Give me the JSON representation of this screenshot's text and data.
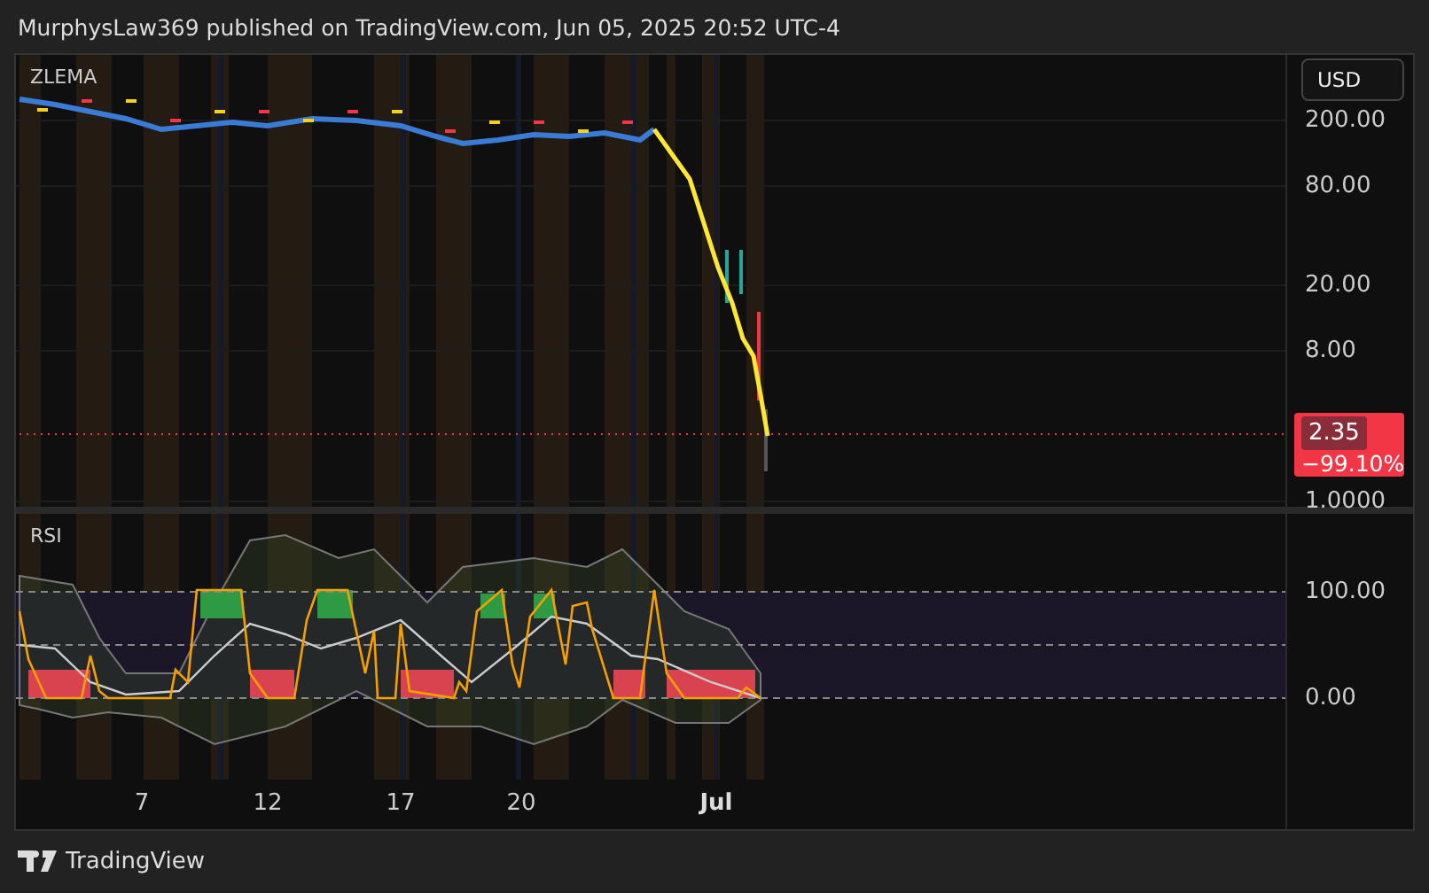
{
  "header": {
    "text": "MurphysLaw369 published on TradingView.com, Jun 05, 2025 20:52 UTC-4"
  },
  "price_pane": {
    "indicator": "ZLEMA",
    "currency": "USD",
    "axis_labels": [
      "200.00",
      "80.00",
      "20.00",
      "8.00",
      "1.0000"
    ],
    "last_price": "2.35",
    "change": "−99.10%"
  },
  "rsi_pane": {
    "indicator": "RSI",
    "axis_labels": [
      "100.00",
      "0.00"
    ]
  },
  "time_axis": [
    {
      "label": "7",
      "kind": "day"
    },
    {
      "label": "12",
      "kind": "day"
    },
    {
      "label": "17",
      "kind": "day"
    },
    {
      "label": "20",
      "kind": "day"
    },
    {
      "label": "Jul",
      "kind": "month"
    }
  ],
  "footer": {
    "brand": "TradingView"
  }
}
